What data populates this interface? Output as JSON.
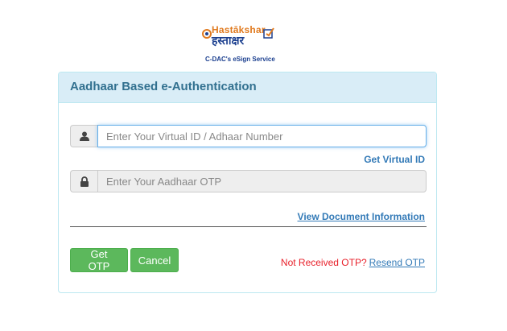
{
  "logo": {
    "brand_en": "Hastākshar",
    "brand_hi": "हस्ताक्षर",
    "tagline": "C-DAC's eSign Service"
  },
  "panel": {
    "title": "Aadhaar Based e-Authentication"
  },
  "form": {
    "virtual_id_placeholder": "Enter Your Virtual ID / Adhaar Number",
    "otp_placeholder": "Enter Your Aadhaar OTP",
    "get_virtual_id": "Get Virtual ID",
    "view_document": "View Document Information",
    "get_otp": "Get OTP",
    "cancel": "Cancel",
    "not_received": "Not Received OTP?",
    "resend": "Resend OTP"
  },
  "colors": {
    "accent_blue": "#337ab7",
    "button_green": "#5cb85c",
    "heading_bg": "#d9edf7",
    "warning_red": "#e8202a"
  },
  "icons": {
    "user": "user-icon",
    "lock": "lock-icon"
  }
}
